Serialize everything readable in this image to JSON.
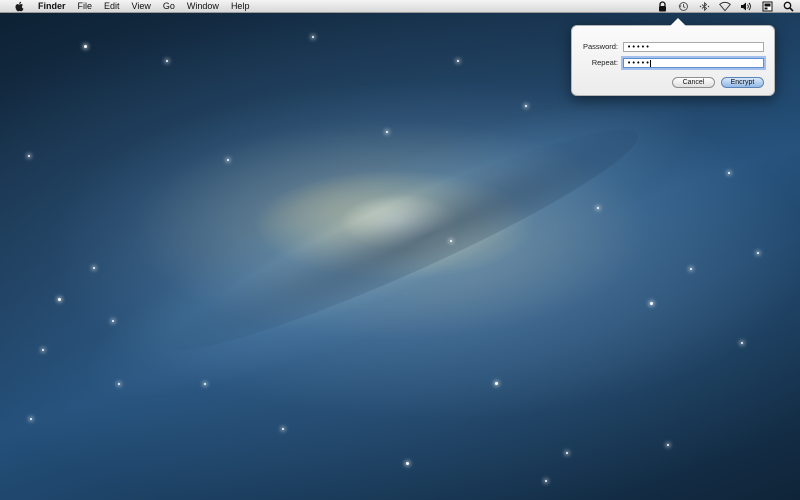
{
  "menubar": {
    "apple_icon": "apple-logo-icon",
    "app_name": "Finder",
    "items": [
      "File",
      "Edit",
      "View",
      "Go",
      "Window",
      "Help"
    ],
    "status_icons": [
      "lock-icon",
      "time-machine-icon",
      "bluetooth-icon",
      "wifi-icon",
      "volume-icon",
      "input-source-icon",
      "spotlight-search-icon"
    ]
  },
  "popover": {
    "password_label": "Password:",
    "password_value": "•••••",
    "repeat_label": "Repeat:",
    "repeat_value": "•••••",
    "cancel_label": "Cancel",
    "encrypt_label": "Encrypt"
  },
  "colors": {
    "menubar_top": "#f4f4f4",
    "menubar_bottom": "#d8d8d8",
    "default_button": "#93b9e6",
    "focus_ring": "#5b8fd6",
    "space_background": "#1b3a58"
  },
  "desktop": {
    "wallpaper": "galaxy"
  }
}
